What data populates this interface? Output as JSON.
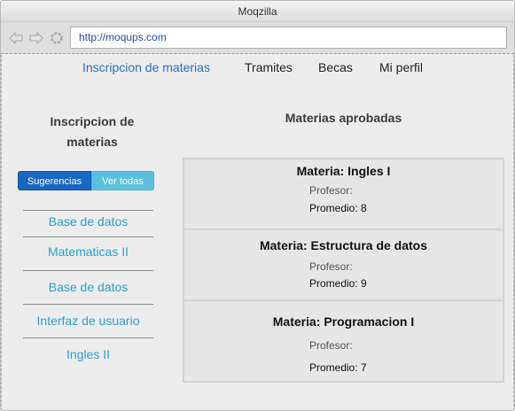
{
  "window": {
    "title": "Moqzilla"
  },
  "browser": {
    "url": "http://moqups.com"
  },
  "nav": {
    "items": [
      {
        "label": "Inscripcion de materias",
        "active": true
      },
      {
        "label": "Tramites"
      },
      {
        "label": "Becas"
      },
      {
        "label": "Mi perfil"
      }
    ]
  },
  "sidebar": {
    "title": "Inscripcion de materias",
    "toggle": {
      "suggestions": "Sugerencias",
      "all": "Ver todas"
    },
    "suggestions": [
      "Base de datos",
      "Matematicas II",
      "Base de datos",
      "Interfaz de usuario",
      "Ingles II"
    ]
  },
  "main": {
    "title": "Materias aprobadas",
    "courses": [
      {
        "name": "Materia: Ingles I",
        "professor": "Profesor:",
        "average": "Promedio: 8"
      },
      {
        "name": "Materia: Estructura de datos",
        "professor": "Profesor:",
        "average": "Promedio: 9"
      },
      {
        "name": "Materia: Programacion I",
        "professor": "Profesor:",
        "average": "Promedio: 7"
      }
    ]
  },
  "colors": {
    "accent": "#2d6fc4",
    "primary_button": "#1967c2",
    "info_button": "#5bc0de",
    "link": "#2d9fd2"
  }
}
